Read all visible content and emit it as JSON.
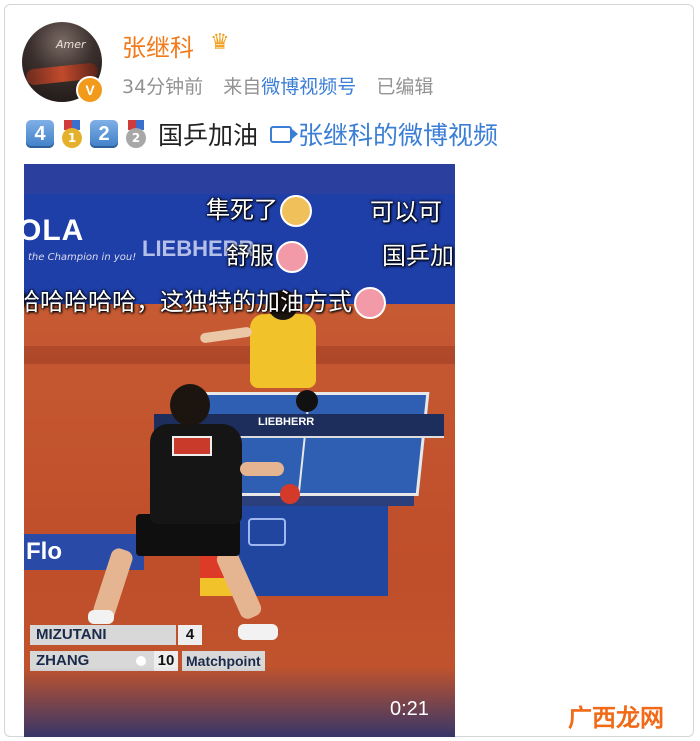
{
  "user": {
    "name": "张继科",
    "verified_badge": "V",
    "avatar_caption": "Amer"
  },
  "meta": {
    "time": "34分钟前",
    "from_label": "来自",
    "source": "微博视频号",
    "edited": "已编辑"
  },
  "post": {
    "num1": "4",
    "num2": "2",
    "medal1": "1",
    "medal2": "2",
    "text": "国乒加油",
    "video_link": "张继科的微博视频"
  },
  "video": {
    "danmaku": [
      "隼死了",
      "可以可",
      "舒服",
      "国乒加",
      "哈哈哈哈哈，这独特的加油方式"
    ],
    "ads": {
      "brand_left": "OLA",
      "tagline": "the Champion in you!",
      "brand_right": "LIEBHERR",
      "net_brand": "LIEBHERR"
    },
    "ad_bottom": "Flo",
    "scoreboard": [
      {
        "name": "MIZUTANI",
        "score": "4"
      },
      {
        "name": "ZHANG",
        "score": "10",
        "note": "Matchpoint"
      }
    ],
    "duration": "0:21"
  },
  "watermark": "广西龙网",
  "colors": {
    "username": "#f27a1a",
    "link": "#3b7ed6",
    "meta": "#939393",
    "watermark": "#f06a18"
  }
}
